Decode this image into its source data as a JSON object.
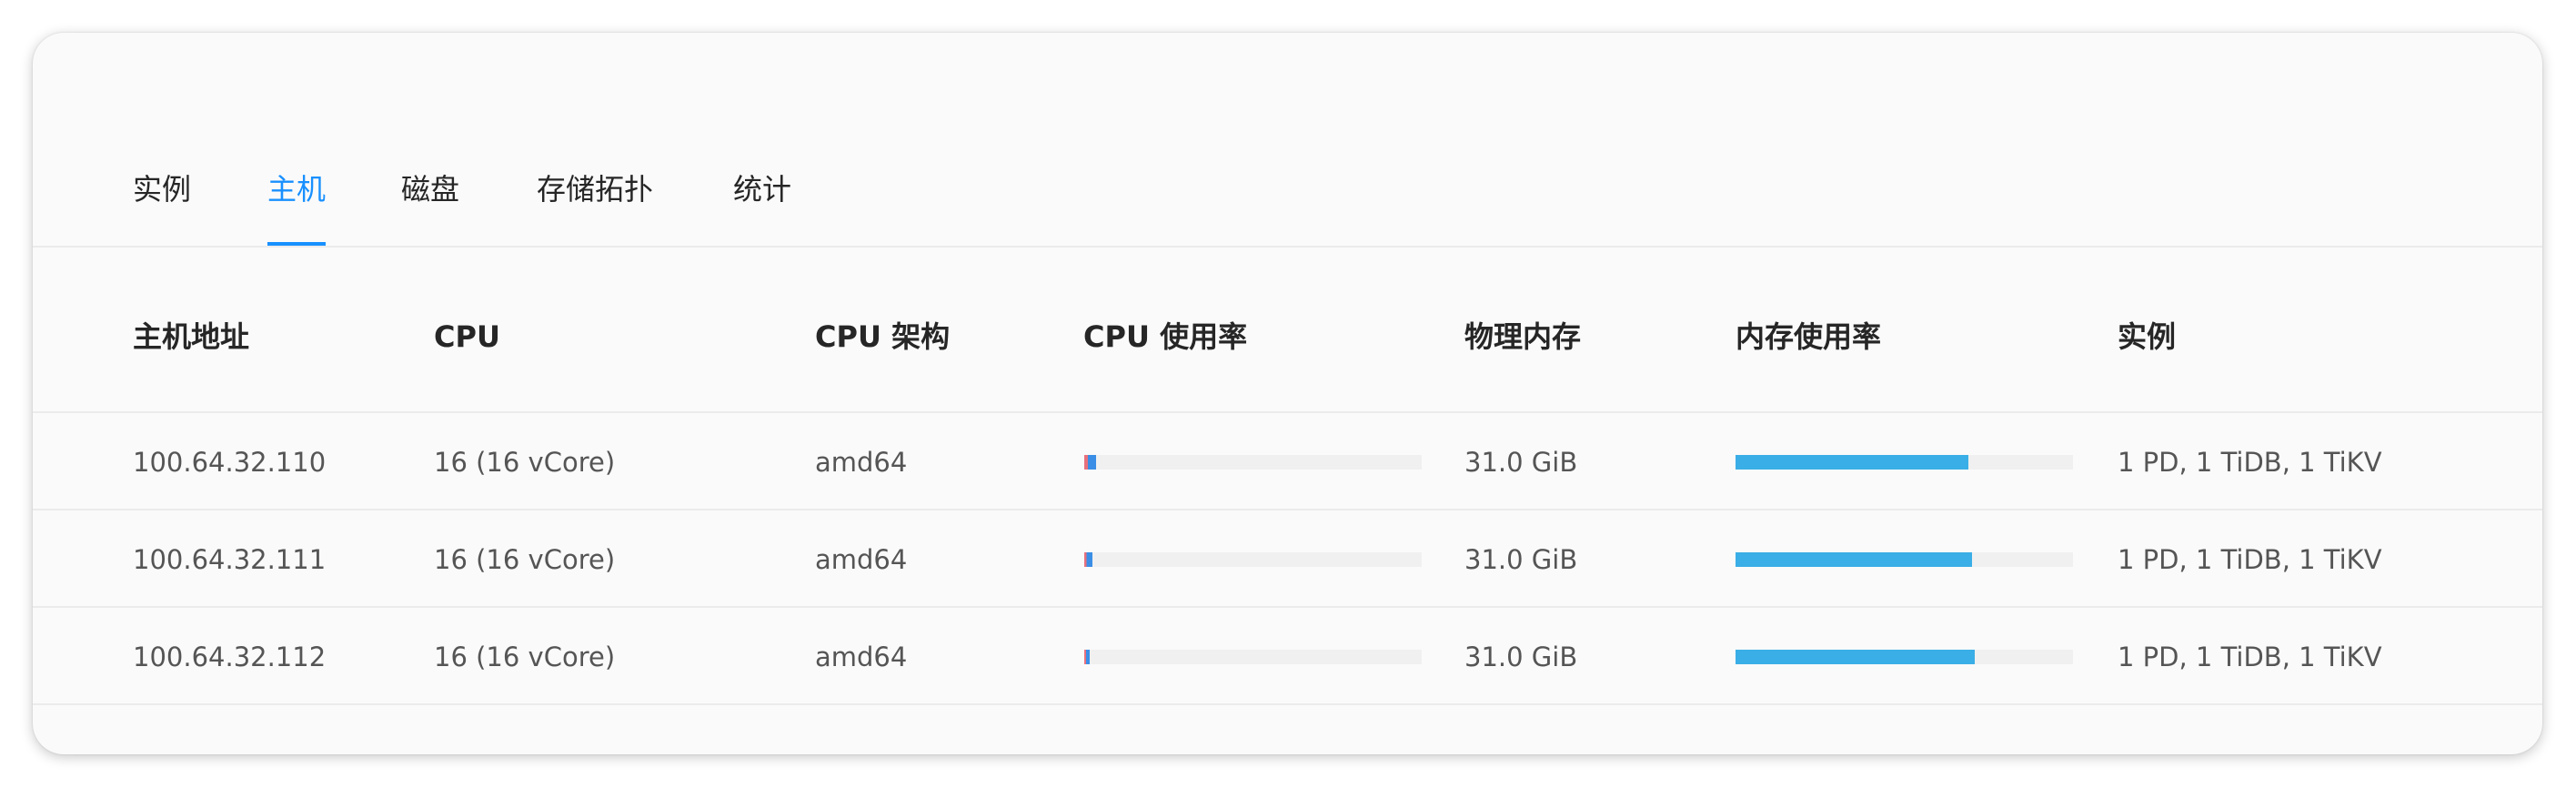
{
  "tabs": [
    {
      "label": "实例",
      "active": false
    },
    {
      "label": "主机",
      "active": true
    },
    {
      "label": "磁盘",
      "active": false
    },
    {
      "label": "存储拓扑",
      "active": false
    },
    {
      "label": "统计",
      "active": false
    }
  ],
  "accent_color": "#1890ff",
  "bar_colors": {
    "cpu_system": "#e8717d",
    "cpu_user": "#3a8ee6",
    "memory": "#3aaee6",
    "track": "#f0f0f0"
  },
  "table": {
    "headers": {
      "address": "主机地址",
      "cpu": "CPU",
      "arch": "CPU 架构",
      "cpu_usage": "CPU 使用率",
      "memory": "物理内存",
      "memory_usage": "内存使用率",
      "instances": "实例"
    },
    "rows": [
      {
        "address": "100.64.32.110",
        "cpu": "16 (16 vCore)",
        "arch": "amd64",
        "cpu_usage_pct": 3.5,
        "memory": "31.0 GiB",
        "memory_usage_pct": 69,
        "instances": "1 PD, 1 TiDB, 1 TiKV"
      },
      {
        "address": "100.64.32.111",
        "cpu": "16 (16 vCore)",
        "arch": "amd64",
        "cpu_usage_pct": 2.5,
        "memory": "31.0 GiB",
        "memory_usage_pct": 70,
        "instances": "1 PD, 1 TiDB, 1 TiKV"
      },
      {
        "address": "100.64.32.112",
        "cpu": "16 (16 vCore)",
        "arch": "amd64",
        "cpu_usage_pct": 1.5,
        "memory": "31.0 GiB",
        "memory_usage_pct": 71,
        "instances": "1 PD, 1 TiDB, 1 TiKV"
      }
    ]
  }
}
